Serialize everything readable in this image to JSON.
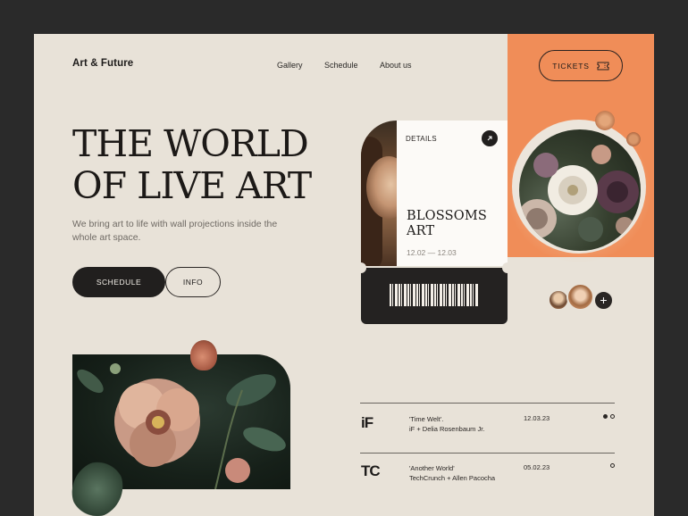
{
  "brand": {
    "logo": "Art & Future"
  },
  "nav": {
    "items": [
      "Gallery",
      "Schedule",
      "About us"
    ]
  },
  "header": {
    "tickets_label": "TICKETS"
  },
  "hero": {
    "title_line1": "THE WORLD",
    "title_line2": "OF LIVE ART",
    "subtitle": "We bring art to life with wall projections inside the whole art space.",
    "schedule_label": "SCHEDULE",
    "info_label": "INFO"
  },
  "event_card": {
    "details_label": "DETAILS",
    "name_line1": "BLOSSOMS",
    "name_line2": "ART",
    "dates": "12.02 — 12.03"
  },
  "colors": {
    "background": "#e8e2d8",
    "accent": "#f08d58",
    "dark": "#211f1e"
  },
  "press": [
    {
      "logo": "iF",
      "quote": "'Time Welt'.",
      "author": "iF + Delia Rosenbaum Jr.",
      "date": "12.03.23",
      "dots": [
        true,
        false
      ]
    },
    {
      "logo": "TC",
      "quote": "'Another World'",
      "author": "TechCrunch + Allen Pacocha",
      "date": "05.02.23",
      "dots": [
        false
      ]
    }
  ]
}
